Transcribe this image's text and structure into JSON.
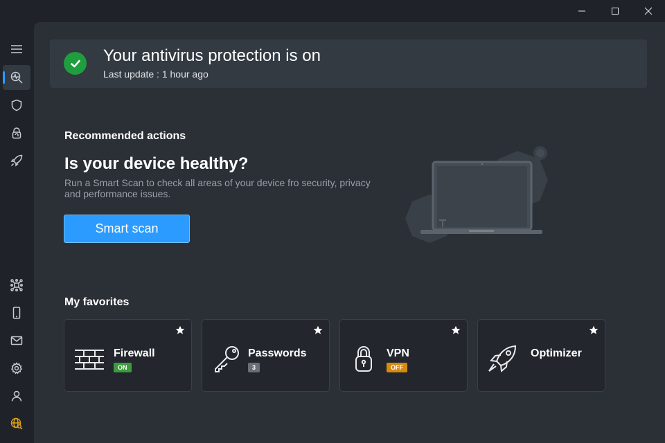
{
  "window": {
    "controls": [
      "minimize-icon",
      "maximize-icon",
      "close-icon"
    ]
  },
  "sidebar": {
    "items": [
      {
        "name": "menu",
        "icon": "hamburger-icon",
        "active": false
      },
      {
        "name": "status",
        "icon": "magnifier-pulse-icon",
        "active": true
      },
      {
        "name": "protection",
        "icon": "shield-icon",
        "active": false
      },
      {
        "name": "privacy",
        "icon": "fingerprint-lock-icon",
        "active": false
      },
      {
        "name": "performance",
        "icon": "rocket-icon",
        "active": false
      },
      {
        "name": "network",
        "icon": "network-icon",
        "active": false
      },
      {
        "name": "mobile",
        "icon": "phone-icon",
        "active": false
      },
      {
        "name": "notifications",
        "icon": "mail-icon",
        "active": false
      },
      {
        "name": "settings",
        "icon": "gear-icon",
        "active": false
      },
      {
        "name": "account",
        "icon": "user-icon",
        "active": false
      },
      {
        "name": "upgrade",
        "icon": "globe-key-icon",
        "active": false
      }
    ]
  },
  "status": {
    "title": "Your antivirus protection is on",
    "subtitle": "Last update : 1 hour ago"
  },
  "recommended": {
    "heading": "Recommended actions",
    "title": "Is your device healthy?",
    "description": "Run a Smart Scan to check all areas of your device fro security, privacy and performance issues.",
    "button_label": "Smart scan"
  },
  "favorites": {
    "heading": "My favorites",
    "items": [
      {
        "label": "Firewall",
        "badge": "ON",
        "badge_color": "#3d9a3d",
        "icon": "firewall-icon"
      },
      {
        "label": "Passwords",
        "badge": "3",
        "badge_color": "#6a6f76",
        "icon": "key-icon"
      },
      {
        "label": "VPN",
        "badge": "OFF",
        "badge_color": "#d68a10",
        "icon": "lock-icon"
      },
      {
        "label": "Optimizer",
        "badge": "",
        "badge_color": "",
        "icon": "rocket-icon"
      }
    ]
  },
  "colors": {
    "accent": "#2b9bff",
    "success": "#1e9e3e",
    "background": "#1f2329",
    "panel": "#2b3037"
  }
}
